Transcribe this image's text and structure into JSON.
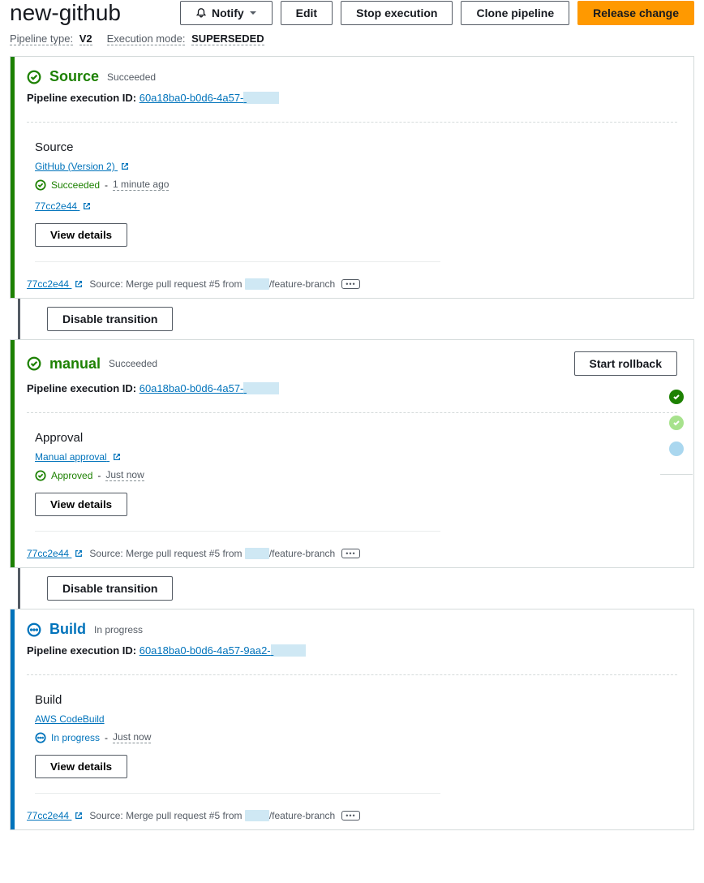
{
  "header": {
    "title": "new-github",
    "notify": "Notify",
    "edit": "Edit",
    "stop": "Stop execution",
    "clone": "Clone pipeline",
    "release": "Release change"
  },
  "meta": {
    "pipeline_type_label": "Pipeline type:",
    "pipeline_type_value": "V2",
    "execution_mode_label": "Execution mode:",
    "execution_mode_value": "SUPERSEDED"
  },
  "stages": [
    {
      "name": "Source",
      "status_label": "Succeeded",
      "status_kind": "success",
      "exec_label": "Pipeline execution ID:",
      "exec_id_visible": "60a18ba0-b0d6-4a57-",
      "action": {
        "title": "Source",
        "provider": "GitHub (Version 2)",
        "status_text": "Succeeded",
        "time": "1 minute ago",
        "commit_short": "77cc2e44",
        "view_details": "View details"
      },
      "commit_row": {
        "commit": "77cc2e44",
        "prefix": "Source: Merge pull request #5 from ",
        "redacted": "xxxxx",
        "suffix": "/feature-branch"
      }
    },
    {
      "transition_label": "Disable transition"
    },
    {
      "name": "manual",
      "status_label": "Succeeded",
      "status_kind": "success",
      "rollback": "Start rollback",
      "exec_label": "Pipeline execution ID:",
      "exec_id_visible": "60a18ba0-b0d6-4a57-",
      "action": {
        "title": "Approval",
        "provider": "Manual approval",
        "status_text": "Approved",
        "time": "Just now",
        "view_details": "View details"
      },
      "commit_row": {
        "commit": "77cc2e44",
        "prefix": "Source: Merge pull request #5 from ",
        "redacted": "xxxxx",
        "suffix": "/feature-branch"
      }
    },
    {
      "transition_label": "Disable transition"
    },
    {
      "name": "Build",
      "status_label": "In progress",
      "status_kind": "progress",
      "exec_label": "Pipeline execution ID:",
      "exec_id_visible": "60a18ba0-b0d6-4a57-9aa2-",
      "action": {
        "title": "Build",
        "provider": "AWS CodeBuild",
        "status_text": "In progress",
        "time": "Just now",
        "view_details": "View details"
      },
      "commit_row": {
        "commit": "77cc2e44",
        "prefix": "Source: Merge pull request #5 from ",
        "redacted": "xxxxx",
        "suffix": "/feature-branch"
      }
    }
  ]
}
